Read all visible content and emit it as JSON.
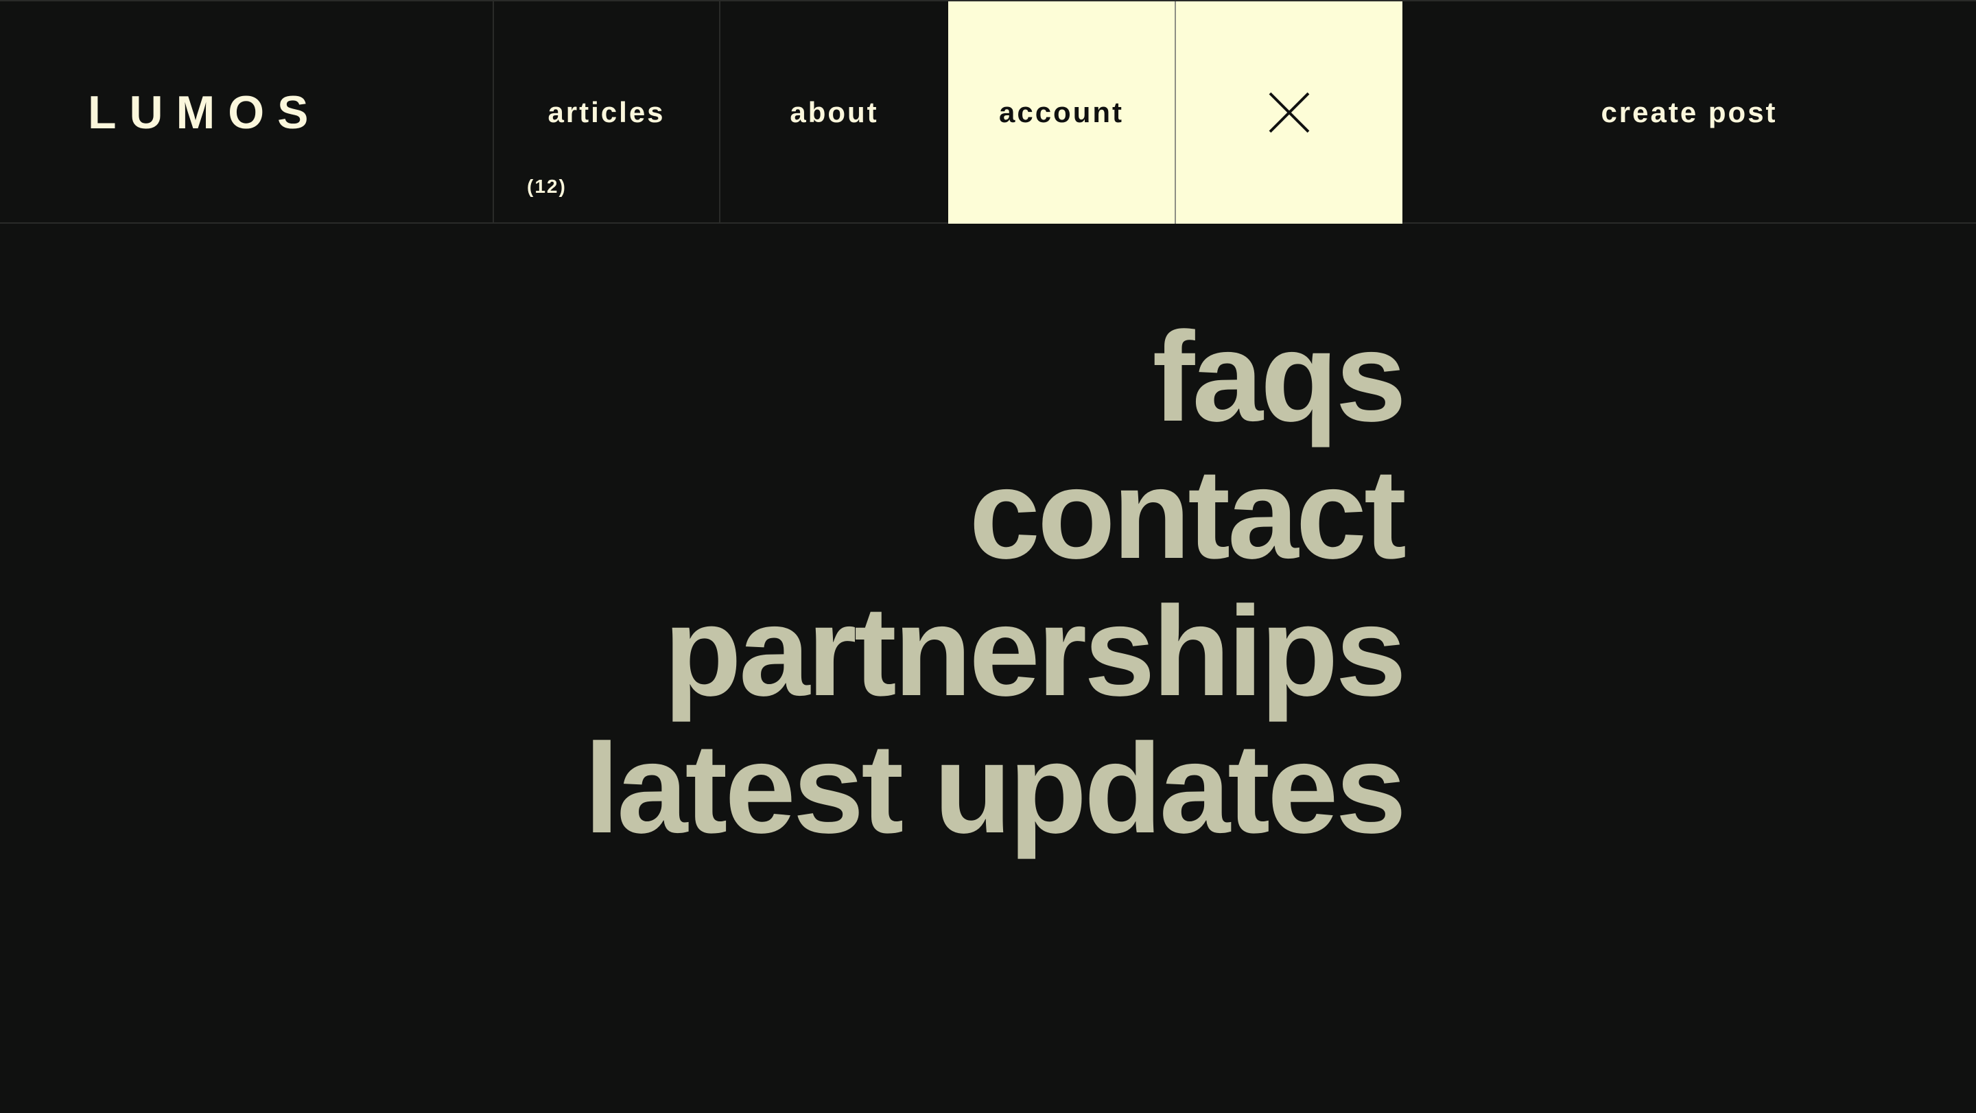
{
  "header": {
    "brand": "LUMOS",
    "nav": {
      "articles_label": "articles",
      "articles_count": "(12)",
      "about_label": "about",
      "account_label": "account",
      "create_post_label": "create post"
    },
    "close_icon": "close-icon"
  },
  "menu": {
    "items": [
      {
        "label": "faqs"
      },
      {
        "label": "contact"
      },
      {
        "label": "partnerships"
      },
      {
        "label": "latest updates"
      }
    ]
  },
  "colors": {
    "background": "#101110",
    "header_text": "#fbf7dc",
    "active_background": "#fdfdd7",
    "menu_text": "#c3c4a8"
  }
}
